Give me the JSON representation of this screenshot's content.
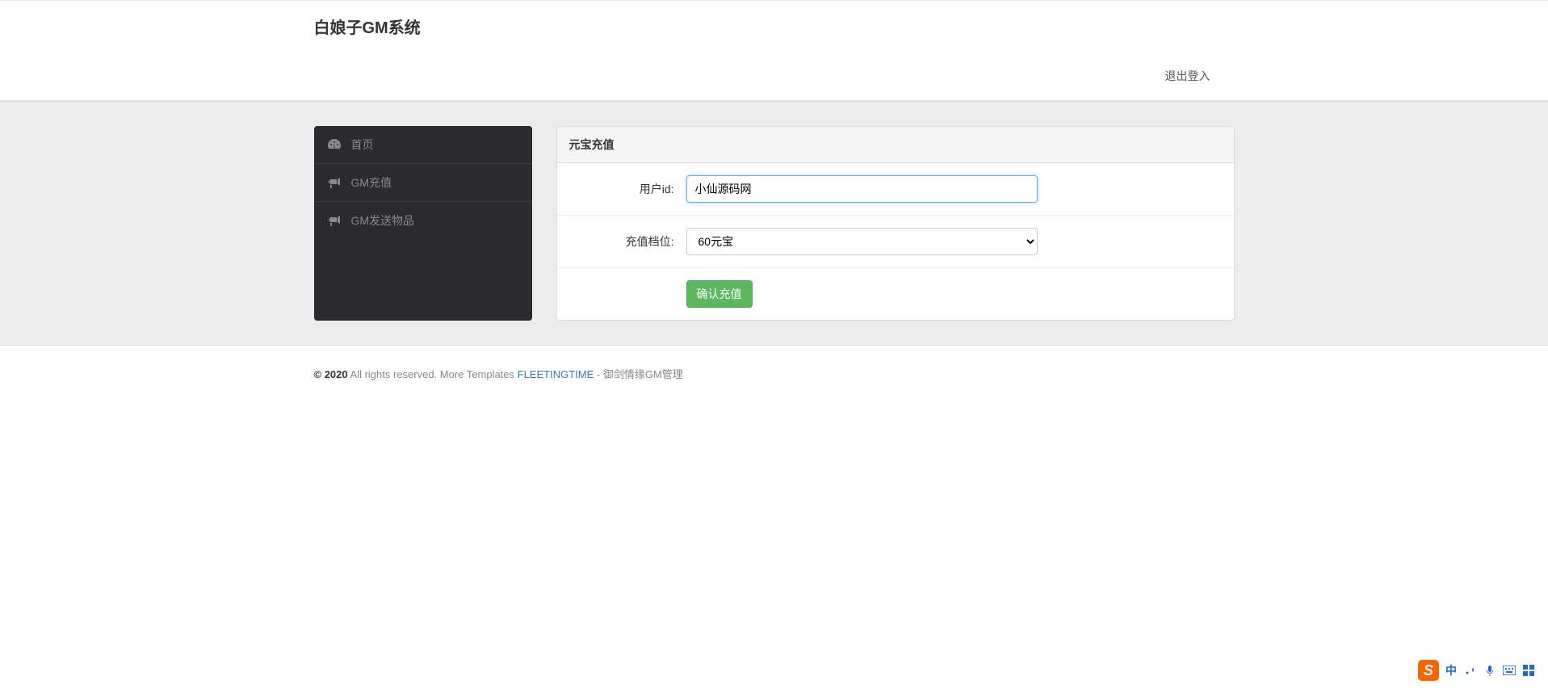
{
  "header": {
    "brand": "白娘子GM系统",
    "logout": "退出登入"
  },
  "sidebar": {
    "items": [
      {
        "label": "首页",
        "icon": "dashboard"
      },
      {
        "label": "GM充值",
        "icon": "bullhorn"
      },
      {
        "label": "GM发送物品",
        "icon": "bullhorn"
      }
    ]
  },
  "panel": {
    "title": "元宝充值",
    "form": {
      "user_id_label": "用户id:",
      "user_id_value": "小仙源码网",
      "tier_label": "充值档位:",
      "tier_value": "60元宝",
      "submit_label": "确认充值"
    }
  },
  "footer": {
    "copyright_strong": "© 2020",
    "rights": " All rights reserved. More Templates ",
    "link": "FLEETINGTIME",
    "suffix": " - 御剑情缘GM管理"
  },
  "ime": {
    "logo": "S",
    "lang": "中"
  }
}
